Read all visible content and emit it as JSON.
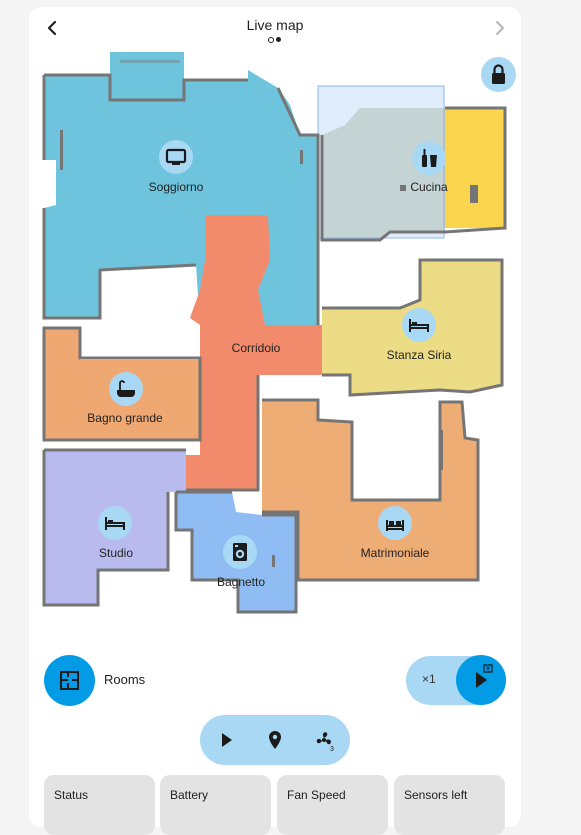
{
  "header": {
    "title": "Live map",
    "back_icon": "chevron-left-icon",
    "next_icon": "chevron-right-icon",
    "page_count": 2,
    "active_page": 2
  },
  "lock": {
    "icon": "lock-icon"
  },
  "colors": {
    "accent": "#039be5",
    "accent_light": "#a9d8f5",
    "wall": "#757575",
    "selection": "#c4def9"
  },
  "rooms": [
    {
      "id": "soggiorno",
      "label": "Soggiorno",
      "icon": "tv-icon",
      "color": "#6ec4dc"
    },
    {
      "id": "cucina",
      "label": "Cucina",
      "icon": "bottles-icon",
      "color": "#c4c6a4"
    },
    {
      "id": "corridoio",
      "label": "Corridoio",
      "icon": "",
      "color": "#f28b6b"
    },
    {
      "id": "stanza-siria",
      "label": "Stanza Siria",
      "icon": "bed-icon",
      "color": "#ecdc85"
    },
    {
      "id": "bagno-grande",
      "label": "Bagno grande",
      "icon": "bathtub-icon",
      "color": "#efa872"
    },
    {
      "id": "studio",
      "label": "Studio",
      "icon": "bed-icon",
      "color": "#b9bbef"
    },
    {
      "id": "bagnetto",
      "label": "Bagnetto",
      "icon": "washing-machine-icon",
      "color": "#8fbcf2"
    },
    {
      "id": "matrimoniale",
      "label": "Matrimoniale",
      "icon": "bed-double-icon",
      "color": "#efad76"
    }
  ],
  "controls": {
    "rooms_label": "Rooms",
    "rooms_icon": "floor-plan-icon",
    "multiplier": "×1",
    "start_icon": "play-rooms-icon",
    "pill_icons": [
      "play-icon",
      "location-pin-icon",
      "fan-speed-icon"
    ]
  },
  "tiles": [
    {
      "label": "Status"
    },
    {
      "label": "Battery"
    },
    {
      "label": "Fan Speed"
    },
    {
      "label": "Sensors left"
    }
  ]
}
